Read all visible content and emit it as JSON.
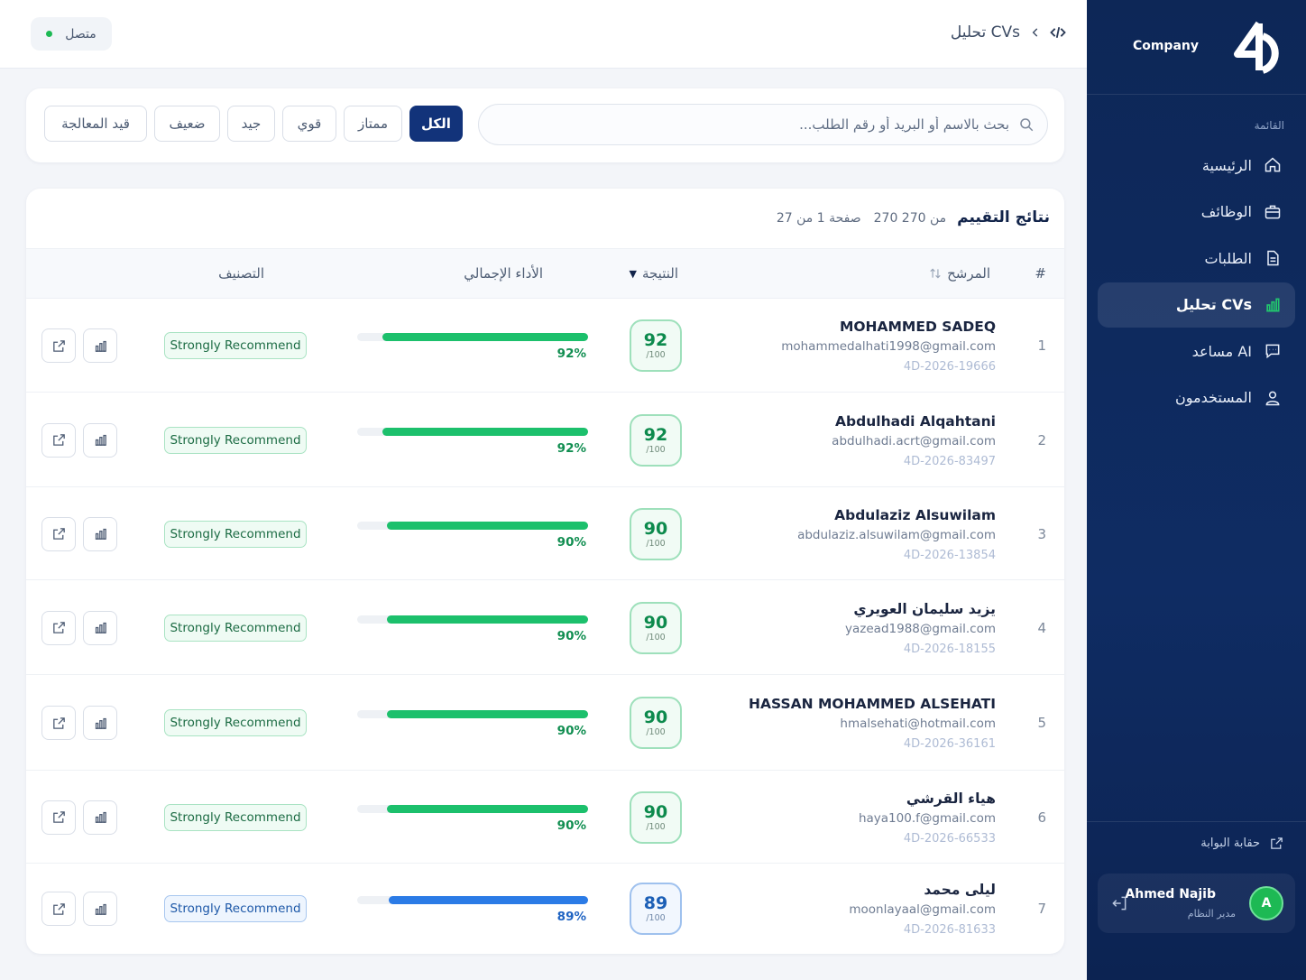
{
  "sidebar": {
    "brand": "Company",
    "menu_caption": "القائمة",
    "items": [
      {
        "label": "الرئيسية",
        "icon": "home-icon"
      },
      {
        "label": "الوظائف",
        "icon": "briefcase-icon"
      },
      {
        "label": "الطلبات",
        "icon": "document-icon"
      },
      {
        "label": "تحليل CVs",
        "icon": "bar-chart-icon",
        "active": true
      },
      {
        "label": "مساعد AI",
        "icon": "chat-icon"
      },
      {
        "label": "المستخدمون",
        "icon": "users-icon"
      }
    ],
    "portal_link": "حقابة البوابة",
    "user": {
      "initial": "A",
      "name": "Ahmed Najib",
      "role": "مدير النظام"
    }
  },
  "topbar": {
    "breadcrumb": "تحليل CVs",
    "status": "متصل"
  },
  "filters": {
    "search_placeholder": "بحث بالاسم أو البريد أو رقم الطلب...",
    "chips": [
      "قيد المعالجة",
      "ضعيف",
      "جيد",
      "قوي",
      "ممتاز",
      "الكل"
    ],
    "active_chip": "الكل"
  },
  "results": {
    "title": "نتائج التقييم",
    "count": "270 من 270",
    "page": "صفحة 1 من 27",
    "headers": {
      "num": "#",
      "candidate": "المرشح",
      "score": "النتيجة",
      "performance": "الأداء الإجمالي",
      "classification": "التصنيف"
    },
    "rows": [
      {
        "num": "1",
        "name": "MOHAMMED SADEQ",
        "email": "mohammedalhati1998@gmail.com",
        "code": "4D-2026-19666",
        "score": "92",
        "max": "/100",
        "pct": 92,
        "pct_label": "92%",
        "badge": "Strongly Recommend",
        "tone": "green"
      },
      {
        "num": "2",
        "name": "Abdulhadi Alqahtani",
        "email": "abdulhadi.acrt@gmail.com",
        "code": "4D-2026-83497",
        "score": "92",
        "max": "/100",
        "pct": 92,
        "pct_label": "92%",
        "badge": "Strongly Recommend",
        "tone": "green"
      },
      {
        "num": "3",
        "name": "Abdulaziz Alsuwilam",
        "email": "abdulaziz.alsuwilam@gmail.com",
        "code": "4D-2026-13854",
        "score": "90",
        "max": "/100",
        "pct": 90,
        "pct_label": "90%",
        "badge": "Strongly Recommend",
        "tone": "green"
      },
      {
        "num": "4",
        "name": "يزيد سليمان العويري",
        "email": "yazead1988@gmail.com",
        "code": "4D-2026-18155",
        "score": "90",
        "max": "/100",
        "pct": 90,
        "pct_label": "90%",
        "badge": "Strongly Recommend",
        "tone": "green"
      },
      {
        "num": "5",
        "name": "HASSAN MOHAMMED ALSEHATI",
        "email": "hmalsehati@hotmail.com",
        "code": "4D-2026-36161",
        "score": "90",
        "max": "/100",
        "pct": 90,
        "pct_label": "90%",
        "badge": "Strongly Recommend",
        "tone": "green"
      },
      {
        "num": "6",
        "name": "هياء القرشي",
        "email": "haya100.f@gmail.com",
        "code": "4D-2026-66533",
        "score": "90",
        "max": "/100",
        "pct": 90,
        "pct_label": "90%",
        "badge": "Strongly Recommend",
        "tone": "green"
      },
      {
        "num": "7",
        "name": "ليلى محمد",
        "email": "moonlayaal@gmail.com",
        "code": "4D-2026-81633",
        "score": "89",
        "max": "/100",
        "pct": 89,
        "pct_label": "89%",
        "badge": "Strongly Recommend",
        "tone": "blue"
      }
    ]
  },
  "colors": {
    "sidebar": "#0f2c63",
    "accent": "#12337a",
    "success": "#1cc06c",
    "info": "#2b7be6"
  }
}
